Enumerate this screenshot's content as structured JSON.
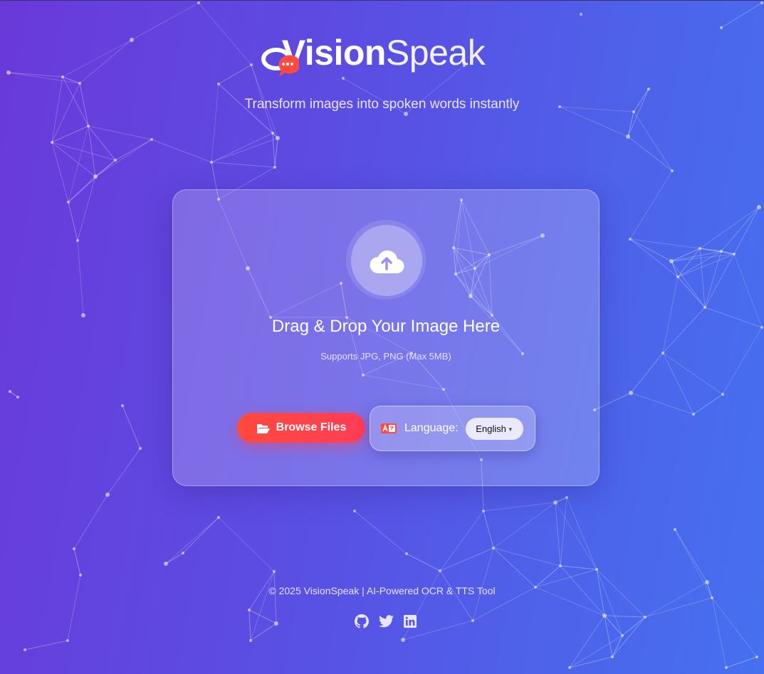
{
  "brand": {
    "bold": "Vision",
    "light": "Speak"
  },
  "tagline": "Transform images into spoken words instantly",
  "upload": {
    "icon": "cloud-upload-icon",
    "title": "Drag & Drop Your Image Here",
    "subtitle": "Supports JPG, PNG (Max 5MB)"
  },
  "actions": {
    "browse_label": "Browse Files",
    "browse_icon": "folder-open-icon",
    "language_label": "Language:",
    "language_icon": "language-icon",
    "language_selected": "English"
  },
  "footer": {
    "copyright": "© 2025 VisionSpeak | AI-Powered OCR & TTS Tool",
    "social_icons": [
      "github-icon",
      "twitter-icon",
      "linkedin-icon"
    ]
  },
  "colors": {
    "background_start": "#6a39d9",
    "background_end": "#4670ef",
    "accent": "#ff4a3d"
  }
}
